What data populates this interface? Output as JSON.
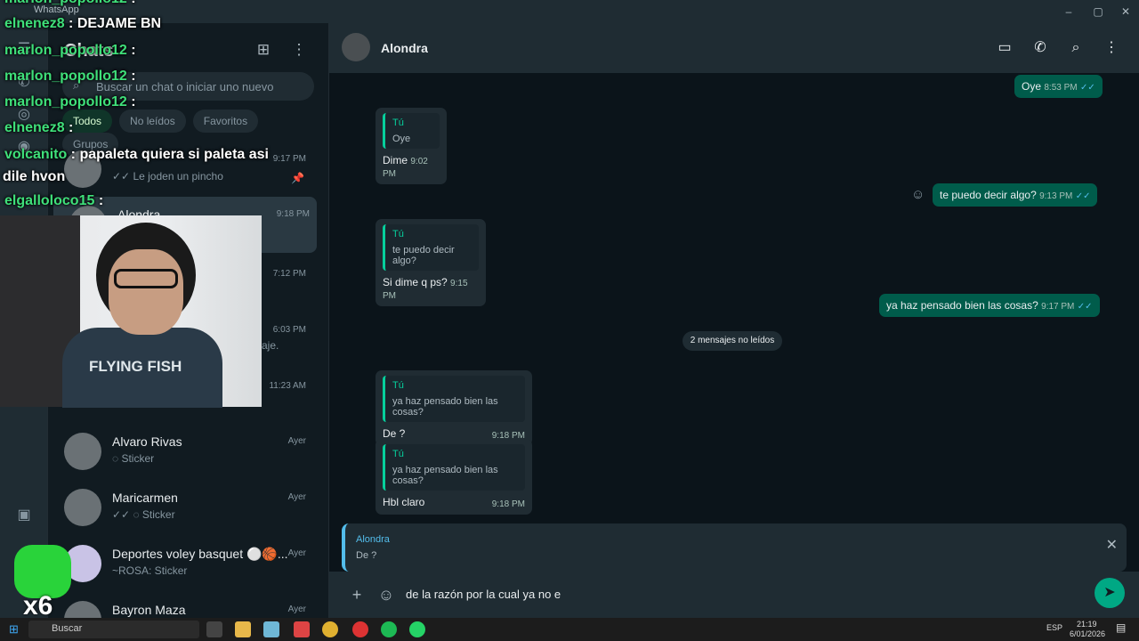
{
  "window": {
    "title": "WhatsApp"
  },
  "sidebar": {
    "header": "Chats",
    "search_placeholder": "Buscar un chat o iniciar uno nuevo",
    "filters": [
      "Todos",
      "No leídos",
      "Favoritos",
      "Grupos"
    ],
    "chats": [
      {
        "name": "",
        "preview": "Le joden un pincho",
        "time": "9:17 PM"
      },
      {
        "name": "Alondra",
        "preview": "",
        "time": "9:18 PM"
      },
      {
        "name": "",
        "preview": "",
        "time": "7:12 PM"
      },
      {
        "name": "",
        "preview": "aje.",
        "time": "6:03 PM"
      },
      {
        "name": "",
        "preview": "",
        "time": "11:23 AM"
      },
      {
        "name": "Alvaro Rivas",
        "preview": "Sticker",
        "time": "Ayer"
      },
      {
        "name": "Maricarmen",
        "preview": "Sticker",
        "time": "Ayer"
      },
      {
        "name": "Deportes voley basquet ⚪🏀...",
        "preview": "~ROSA: Sticker",
        "time": "Ayer"
      },
      {
        "name": "Bayron Maza",
        "preview": "",
        "time": "Ayer"
      }
    ]
  },
  "conversation": {
    "contact": "Alondra",
    "messages": [
      {
        "dir": "out",
        "text": "Oye",
        "time": "8:53 PM"
      },
      {
        "dir": "in",
        "quote_name": "Tú",
        "quote_text": "Oye",
        "text": "Dime",
        "time": "9:02 PM"
      },
      {
        "dir": "out",
        "text": "te puedo decir algo?",
        "time": "9:13 PM"
      },
      {
        "dir": "in",
        "quote_name": "Tú",
        "quote_text": "te puedo decir algo?",
        "text": "Si dime q ps?",
        "time": "9:15 PM"
      },
      {
        "dir": "out",
        "text": "ya haz pensado bien las cosas?",
        "time": "9:17 PM"
      },
      {
        "dir": "in",
        "quote_name": "Tú",
        "quote_text": "ya haz pensado bien las cosas?",
        "text": "De ?",
        "time": "9:18 PM"
      },
      {
        "dir": "in",
        "quote_name": "Tú",
        "quote_text": "ya haz pensado bien las cosas?",
        "text": "Hbl claro",
        "time": "9:18 PM"
      }
    ],
    "unread_divider": "2 mensajes no leídos",
    "reply_to": {
      "name": "Alondra",
      "text": "De ?"
    },
    "composer_text": "de la razón por la cual ya no e"
  },
  "stream_overlay": {
    "lines": [
      {
        "user": "marlon_popollo12",
        "msg": ""
      },
      {
        "user": "elnenez8",
        "msg": "DEJAME BN"
      },
      {
        "user": "marlon_popollo12",
        "msg": ""
      },
      {
        "user": "marlon_popollo12",
        "msg": ""
      },
      {
        "user": "marlon_popollo12",
        "msg": ""
      },
      {
        "user": "elnenez8",
        "msg": ""
      },
      {
        "user": "volcanito",
        "msg": "papaleta quiera si paleta asi"
      },
      {
        "user": "",
        "msg": "dile hvon"
      },
      {
        "user": "elgalloloco15",
        "msg": ""
      }
    ],
    "cam_shirt_text": "FLYING FISH",
    "multiplier": "x6"
  },
  "taskbar": {
    "search": "Buscar",
    "language": "ESP",
    "time": "21:19",
    "date": "6/01/2026"
  },
  "colors": {
    "accent": "#00a884",
    "outgoing": "#005c4b",
    "incoming": "#202c33"
  }
}
